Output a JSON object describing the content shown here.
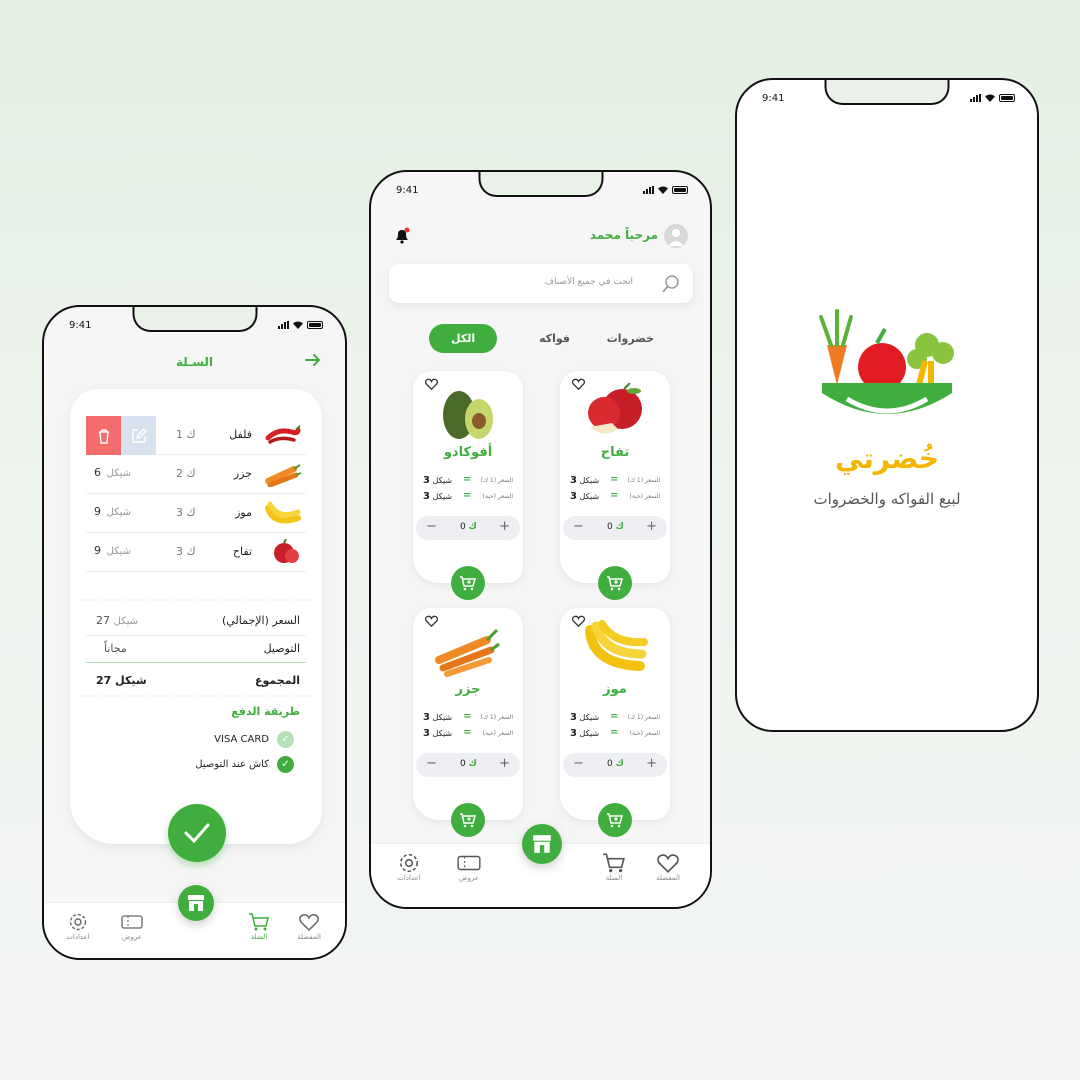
{
  "status_time": "9:41",
  "cart_screen": {
    "title": "السـلة",
    "items": [
      {
        "name": "فلفل",
        "qty": "1 ك",
        "price": "",
        "currency": ""
      },
      {
        "name": "جزر",
        "qty": "2 ك",
        "price": "6",
        "currency": "شيكل"
      },
      {
        "name": "موز",
        "qty": "3 ك",
        "price": "9",
        "currency": "شيكل"
      },
      {
        "name": "تفاح",
        "qty": "3 ك",
        "price": "9",
        "currency": "شيكل"
      }
    ],
    "summary": {
      "subtotal_label": "السعر (الإجمالي)",
      "subtotal_value": "27",
      "subtotal_currency": "شيكل",
      "delivery_label": "التوصيل",
      "delivery_value": "مجاناً",
      "total_label": "المجموع",
      "total_value": "27 شيكل"
    },
    "payment": {
      "title": "طريقة الدفع",
      "options": [
        {
          "label": "VISA CARD",
          "selected": false
        },
        {
          "label": "كاش عند التوصيل",
          "selected": true
        }
      ]
    },
    "tabs": {
      "favorites": "المفضلة",
      "cart": "السلة",
      "offers": "عروض",
      "settings": "اعدادات"
    }
  },
  "home_screen": {
    "greeting": "مرحباً محمد",
    "search_placeholder": "ابحث في جميع الأصناف",
    "categories": {
      "vegetables": "خضروات",
      "fruits": "فواكه",
      "all": "الكل"
    },
    "price_label_kg": "السعر (1 ك)",
    "price_label_pc": "السعر (حبة)",
    "products": [
      {
        "name": "تفاح",
        "price_kg": "3",
        "price_pc": "3",
        "currency": "شيكل",
        "count": "0",
        "unit": "ك"
      },
      {
        "name": "أفوكادو",
        "price_kg": "3",
        "price_pc": "3",
        "currency": "شيكل",
        "count": "0",
        "unit": "ك"
      },
      {
        "name": "موز",
        "price_kg": "3",
        "price_pc": "3",
        "currency": "شيكل",
        "count": "0",
        "unit": "ك"
      },
      {
        "name": "جزر",
        "price_kg": "3",
        "price_pc": "3",
        "currency": "شيكل",
        "count": "0",
        "unit": "ك"
      }
    ],
    "tabs": {
      "favorites": "المفضلة",
      "cart": "السلة",
      "offers": "عروض",
      "settings": "اعدادات"
    }
  },
  "splash_screen": {
    "brand": "خُضرتي",
    "tagline": "لبيع الفواكه والخضروات"
  },
  "colors": {
    "primary": "#3fae3f",
    "brand_yellow": "#f2b600",
    "danger": "#f46d6d"
  }
}
